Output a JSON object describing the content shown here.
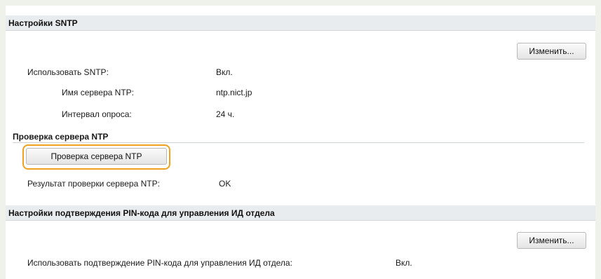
{
  "sntp_section": {
    "title": "Настройки SNTP",
    "edit_button": "Изменить...",
    "use_sntp_label": "Использовать SNTP:",
    "use_sntp_value": "Вкл.",
    "ntp_server_label": "Имя сервера NTP:",
    "ntp_server_value": "ntp.nict.jp",
    "poll_interval_label": "Интервал опроса:",
    "poll_interval_value": "24 ч."
  },
  "ntp_check": {
    "subtitle": "Проверка сервера NTP",
    "button_label": "Проверка сервера NTP",
    "result_label": "Результат проверки сервера NTP:",
    "result_value": "OK"
  },
  "pin_section": {
    "title": "Настройки подтверждения PIN-кода для управления ИД отдела",
    "edit_button": "Изменить...",
    "use_pin_label": "Использовать подтверждение PIN-кода для управления ИД отдела:",
    "use_pin_value": "Вкл."
  },
  "colors": {
    "highlight": "#f0a21e",
    "header_bg": "#e9ecef",
    "background": "#eef2ea"
  }
}
